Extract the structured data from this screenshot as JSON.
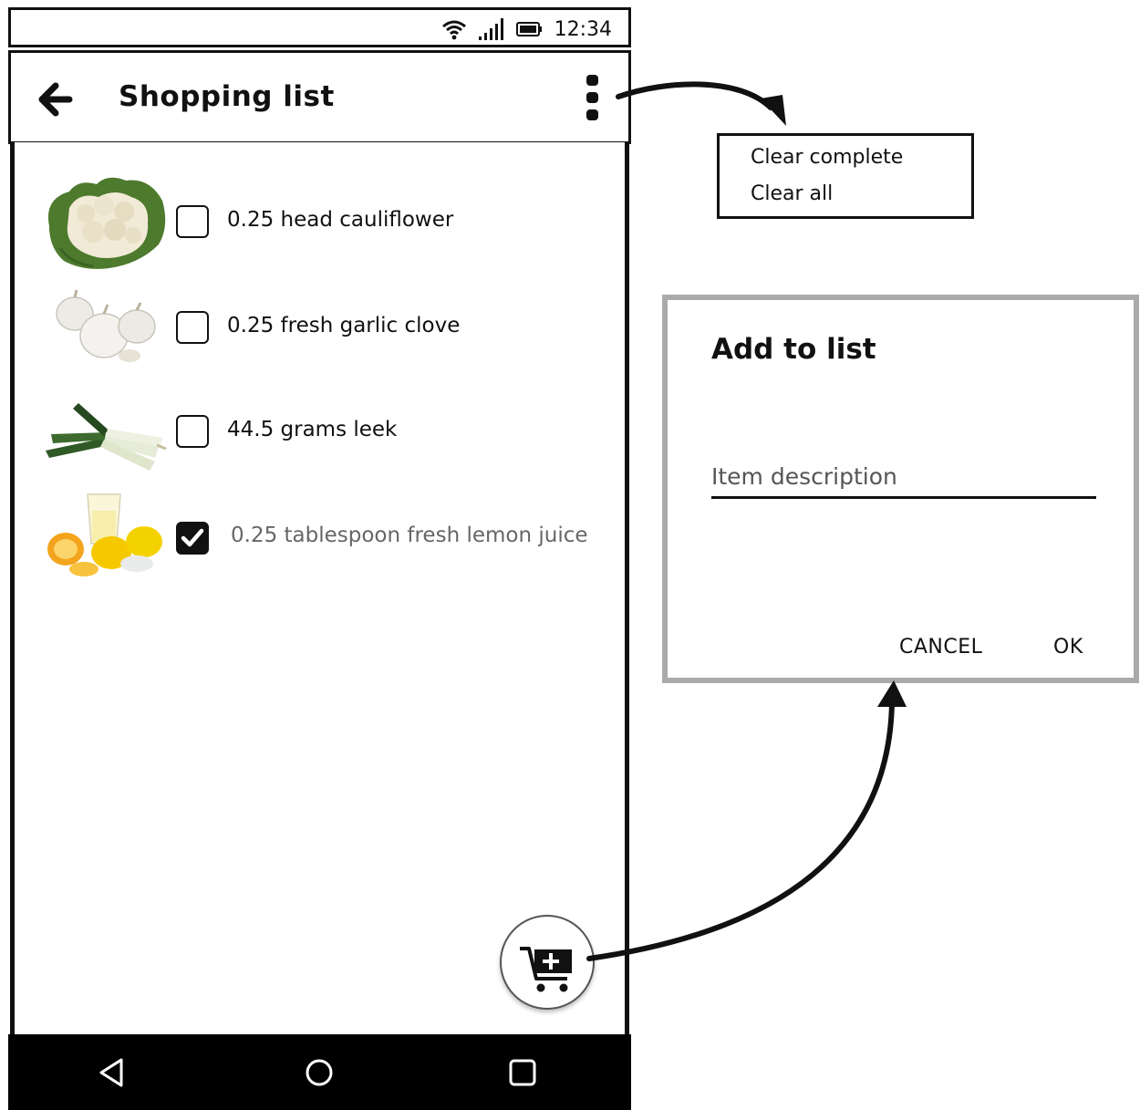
{
  "status_bar": {
    "time": "12:34",
    "icons": [
      "wifi-icon",
      "signal-icon",
      "battery-icon"
    ]
  },
  "app_bar": {
    "back_icon": "arrow-left-icon",
    "title": "Shopping list",
    "overflow_icon": "more-vertical-icon"
  },
  "items": [
    {
      "label": "0.25 head cauliflower",
      "checked": false,
      "image": "cauliflower-image"
    },
    {
      "label": "0.25 fresh garlic clove",
      "checked": false,
      "image": "garlic-image"
    },
    {
      "label": "44.5 grams leek",
      "checked": false,
      "image": "leek-image"
    },
    {
      "label": "0.25 tablespoon fresh lemon juice",
      "checked": true,
      "image": "lemon-image"
    }
  ],
  "fab": {
    "icon": "add-to-cart-icon"
  },
  "nav_bar": {
    "icons": [
      "back-triangle-icon",
      "home-circle-icon",
      "recents-square-icon"
    ]
  },
  "overflow_menu": {
    "items": [
      {
        "label": "Clear complete"
      },
      {
        "label": "Clear all"
      }
    ]
  },
  "dialog": {
    "title": "Add to list",
    "input_placeholder": "Item description",
    "input_value": "",
    "cancel_label": "CANCEL",
    "ok_label": "OK"
  },
  "colors": {
    "ink": "#111111",
    "dialog_border": "#aaaaaa",
    "done_text": "#666666",
    "nav_bar_bg": "#000000"
  }
}
